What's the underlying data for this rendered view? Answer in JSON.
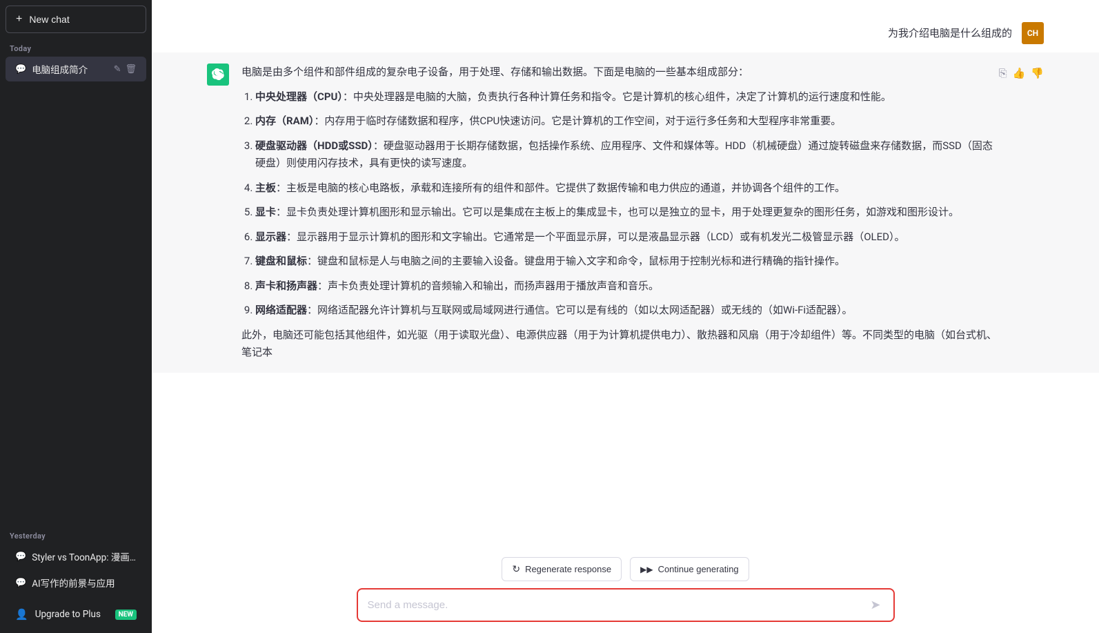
{
  "sidebar": {
    "new_chat_label": "New chat",
    "new_chat_plus": "+",
    "today_label": "Today",
    "active_chat_title": "电脑组成简介",
    "yesterday_label": "Yesterday",
    "yesterday_chats": [
      {
        "title": "Styler vs ToonApp: 漫画脸优差"
      },
      {
        "title": "AI写作的前景与应用"
      }
    ],
    "upgrade_label": "Upgrade to Plus",
    "upgrade_badge": "NEW"
  },
  "header": {
    "user_avatar_text": "CH"
  },
  "user_question": "为我介绍电脑是什么组成的",
  "assistant_response": {
    "intro": "电脑是由多个组件和部件组成的复杂电子设备，用于处理、存储和输出数据。下面是电脑的一些基本组成部分：",
    "items": [
      {
        "title": "中央处理器（CPU）",
        "content": "中央处理器是电脑的大脑，负责执行各种计算任务和指令。它是计算机的核心组件，决定了计算机的运行速度和性能。"
      },
      {
        "title": "内存（RAM）",
        "content": "内存用于临时存储数据和程序，供CPU快速访问。它是计算机的工作空间，对于运行多任务和大型程序非常重要。"
      },
      {
        "title": "硬盘驱动器（HDD或SSD）",
        "content": "硬盘驱动器用于长期存储数据，包括操作系统、应用程序、文件和媒体等。HDD（机械硬盘）通过旋转磁盘来存储数据，而SSD（固态硬盘）则使用闪存技术，具有更快的读写速度。"
      },
      {
        "title": "主板",
        "content": "主板是电脑的核心电路板，承载和连接所有的组件和部件。它提供了数据传输和电力供应的通道，并协调各个组件的工作。"
      },
      {
        "title": "显卡",
        "content": "显卡负责处理计算机图形和显示输出。它可以是集成在主板上的集成显卡，也可以是独立的显卡，用于处理更复杂的图形任务，如游戏和图形设计。"
      },
      {
        "title": "显示器",
        "content": "显示器用于显示计算机的图形和文字输出。它通常是一个平面显示屏，可以是液晶显示器（LCD）或有机发光二极管显示器（OLED）。"
      },
      {
        "title": "键盘和鼠标",
        "content": "键盘和鼠标是人与电脑之间的主要输入设备。键盘用于输入文字和命令，鼠标用于控制光标和进行精确的指针操作。"
      },
      {
        "title": "声卡和扬声器",
        "content": "声卡负责处理计算机的音频输入和输出，而扬声器用于播放声音和音乐。"
      },
      {
        "title": "网络适配器",
        "content": "网络适配器允许计算机与互联网或局域网进行通信。它可以是有线的（如以太网适配器）或无线的（如Wi-Fi适配器）。"
      }
    ],
    "footer": "此外，电脑还可能包括其他组件，如光驱（用于读取光盘）、电源供应器（用于为计算机提供电力）、散热器和风扇（用于冷却组件）等。不同类型的电脑（如台式机、笔记本"
  },
  "bottom_buttons": {
    "regenerate_label": "Regenerate response",
    "continue_label": "Continue generating"
  },
  "input_placeholder": "Send a message.",
  "icons": {
    "plus": "+",
    "chat_bubble": "💬",
    "edit": "✏",
    "trash": "🗑",
    "person": "👤",
    "regenerate": "↻",
    "continue": "▶▶",
    "copy": "⎘",
    "thumbup": "👍",
    "thumbdown": "👎",
    "send": "➤"
  }
}
